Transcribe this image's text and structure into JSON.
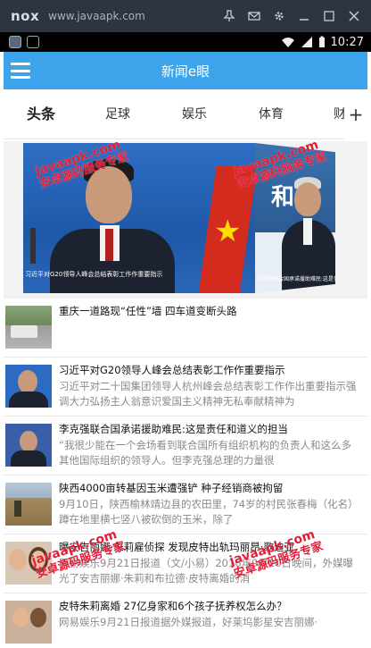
{
  "emulator": {
    "logo": "nox",
    "url": "www.javaapk.com"
  },
  "status_bar": {
    "time": "10:27"
  },
  "header": {
    "title": "新闻e眼"
  },
  "tabs": [
    {
      "label": "头条",
      "active": true
    },
    {
      "label": "足球",
      "active": false
    },
    {
      "label": "娱乐",
      "active": false
    },
    {
      "label": "体育",
      "active": false
    },
    {
      "label": "财",
      "active": false
    }
  ],
  "tab_add_label": "+",
  "banner": {
    "main_caption": "习近平对G20领导人峰会总结表彰工作作重要指示",
    "side_caption": "李克强联合国承诺援助难民:这是责任和道义的担当",
    "side_headline": "和"
  },
  "watermark": {
    "line1": "javaapk.com",
    "line2": "安卓源码服务专家"
  },
  "news": [
    {
      "title": "重庆一道路现“任性”墙 四车道变断头路",
      "summary": ""
    },
    {
      "title": "习近平对G20领导人峰会总结表彰工作作重要指示",
      "summary": "习近平对二十国集团领导人杭州峰会总结表彰工作作出重要指示强调大力弘扬主人翁意识爱国主义精神无私奉献精神为"
    },
    {
      "title": "李克强联合国承诺援助难民:这是责任和道义的担当",
      "summary": "“我很少能在一个会场看到联合国所有组织机构的负责人和这么多其他国际组织的领导人。但李克强总理的力量很"
    },
    {
      "title": "陕西4000亩转基因玉米遭强铲 种子经销商被拘留",
      "summary": "9月10日，陕西榆林靖边县的农田里，74岁的村民张春梅（化名）蹲在地里横七竖八被砍倒的玉米，除了"
    },
    {
      "title": "曝安吉丽娜·朱莉雇侦探 发现皮特出轨玛丽昂·歌迪亚",
      "summary": "网易娱乐9月21日报道（文/小易）2016年9月20日晚间，外媒曝光了安吉丽娜·朱莉和布拉德·皮特离婚的消"
    },
    {
      "title": "皮特朱莉离婚 27亿身家和6个孩子抚养权怎么办？",
      "summary": "网易娱乐9月21日报道据外媒报道，好莱坞影星安吉丽娜·"
    }
  ],
  "colors": {
    "header_bg": "#3da3ea",
    "watermark": "#e0203a",
    "summary_text": "#8a8a8a"
  }
}
